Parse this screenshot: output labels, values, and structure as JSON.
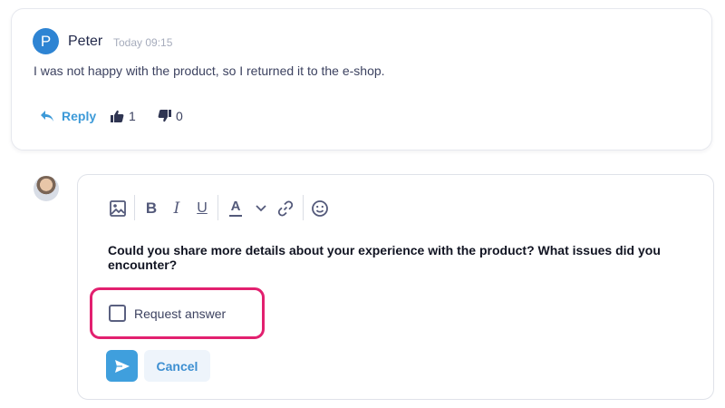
{
  "comment": {
    "avatar_letter": "P",
    "author": "Peter",
    "timestamp": "Today 09:15",
    "text": "I was not happy with the product, so I returned it to the e-shop.",
    "reply_label": "Reply",
    "likes": "1",
    "dislikes": "0"
  },
  "editor": {
    "toolbar": [
      "image-icon",
      "bold",
      "italic",
      "underline",
      "text-color",
      "chevron-down-icon",
      "link-icon",
      "emoji-icon"
    ],
    "bold_label": "B",
    "italic_label": "I",
    "underline_label": "U",
    "color_label": "A",
    "content": "Could you share more details about your experience with the product? What issues did you encounter?",
    "checkbox_label": "Request answer",
    "checkbox_checked": false,
    "cancel_label": "Cancel"
  },
  "colors": {
    "accent": "#3f9fdd",
    "highlight": "#e2206f",
    "avatar_bg": "#2e84d3"
  }
}
